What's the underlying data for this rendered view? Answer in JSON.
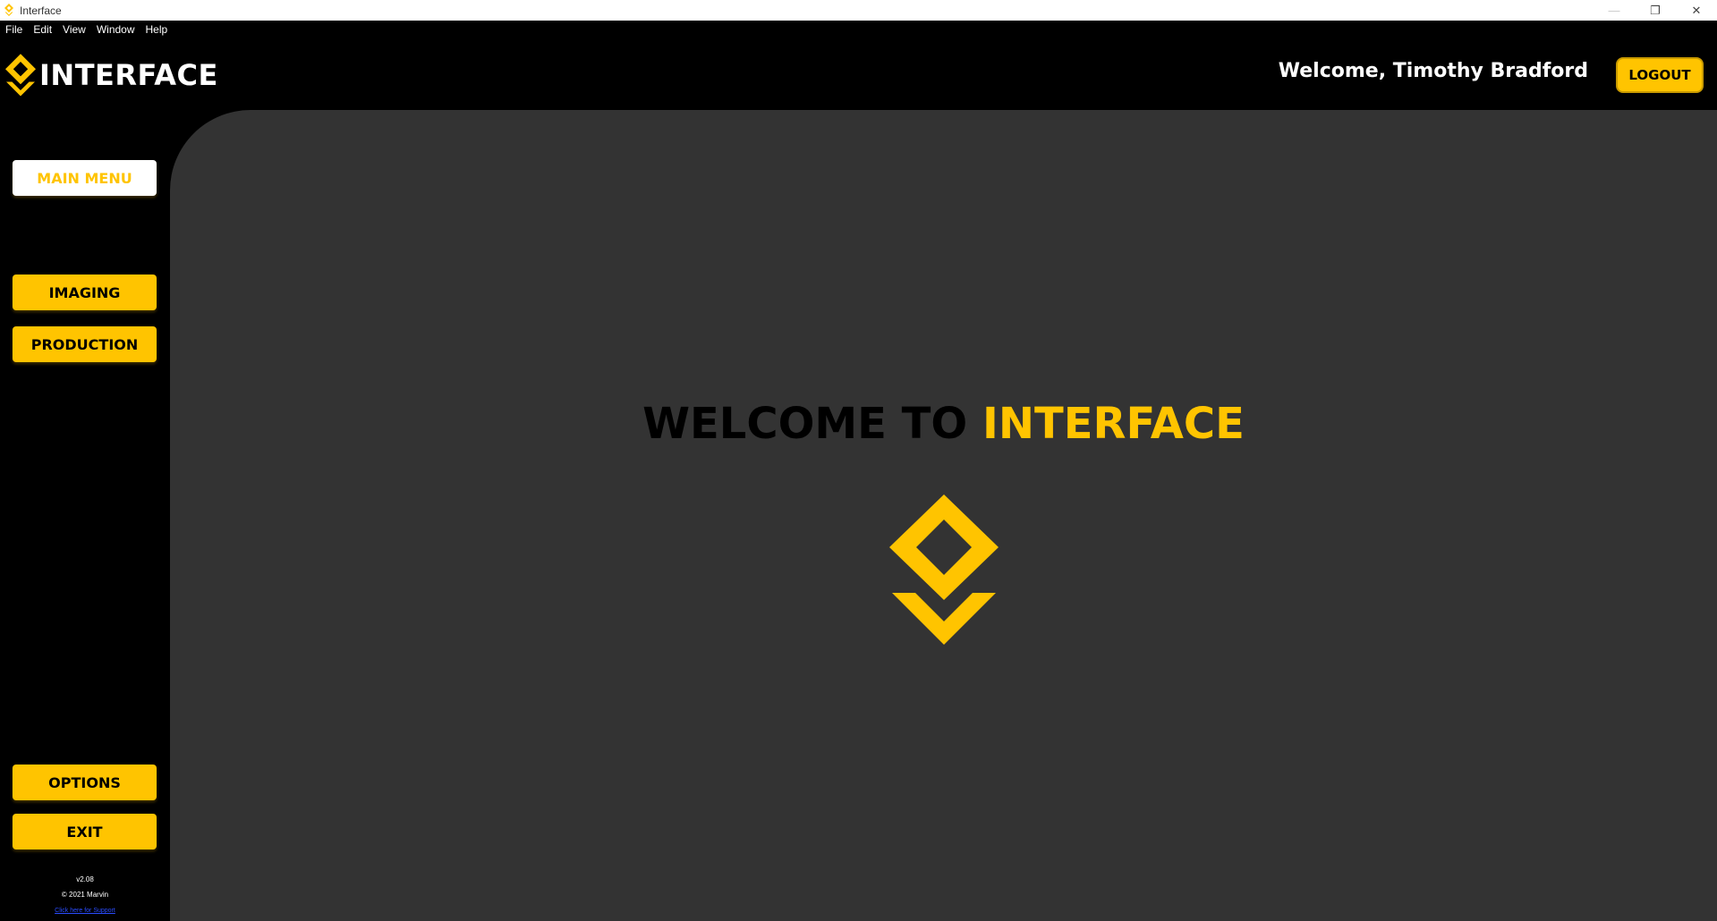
{
  "window": {
    "title": "Interface",
    "controls": {
      "minimize": "—",
      "restore": "❐",
      "close": "✕"
    }
  },
  "menubar": {
    "items": [
      "File",
      "Edit",
      "View",
      "Window",
      "Help"
    ]
  },
  "header": {
    "brand": "INTERFACE",
    "welcome": "Welcome, Timothy Bradford",
    "logout_label": "LOGOUT"
  },
  "sidebar": {
    "main_menu": "MAIN MENU",
    "imaging": "IMAGING",
    "production": "PRODUCTION",
    "options": "OPTIONS",
    "exit": "EXIT",
    "version": "v2.08",
    "copyright": "© 2021 Marvin",
    "link": "Click here for Support"
  },
  "main": {
    "welcome_prefix": "WELCOME TO",
    "welcome_brand": "INTERFACE"
  },
  "colors": {
    "accent": "#FFC400",
    "background": "#000000",
    "panel": "#333333"
  },
  "icons": {
    "brand": "interface-logo-icon",
    "hero": "interface-logo-icon"
  }
}
